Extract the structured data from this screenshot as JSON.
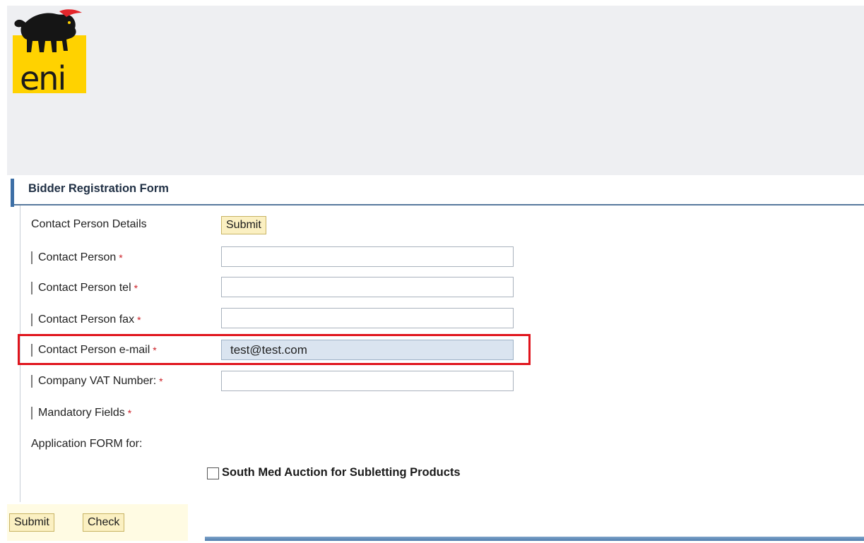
{
  "logo": {
    "text": "eni"
  },
  "form": {
    "title": "Bidder Registration Form",
    "section_label": "Contact Person Details",
    "section_submit_label": "Submit",
    "fields": [
      {
        "label": "Contact Person",
        "required_mark": "*",
        "value": ""
      },
      {
        "label": "Contact Person tel",
        "required_mark": "*",
        "value": ""
      },
      {
        "label": "Contact Person fax",
        "required_mark": "*",
        "value": ""
      },
      {
        "label": "Contact Person e-mail",
        "required_mark": "*",
        "value": "test@test.com"
      },
      {
        "label": "Company VAT Number:",
        "required_mark": "*",
        "value": ""
      }
    ],
    "mandatory_note": {
      "label": "Mandatory Fields",
      "required_mark": "*"
    },
    "application_label": "Application FORM for:",
    "checkbox": {
      "label": "South Med Auction for Subletting Products",
      "checked": false
    }
  },
  "footer": {
    "submit_label": "Submit",
    "check_label": "Check"
  },
  "colors": {
    "accent_blue": "#3d6fa6",
    "highlight_red": "#e0141c",
    "button_bg": "#fbf0c2",
    "filled_input_bg": "#dae4f0",
    "logo_yellow": "#ffd200"
  }
}
